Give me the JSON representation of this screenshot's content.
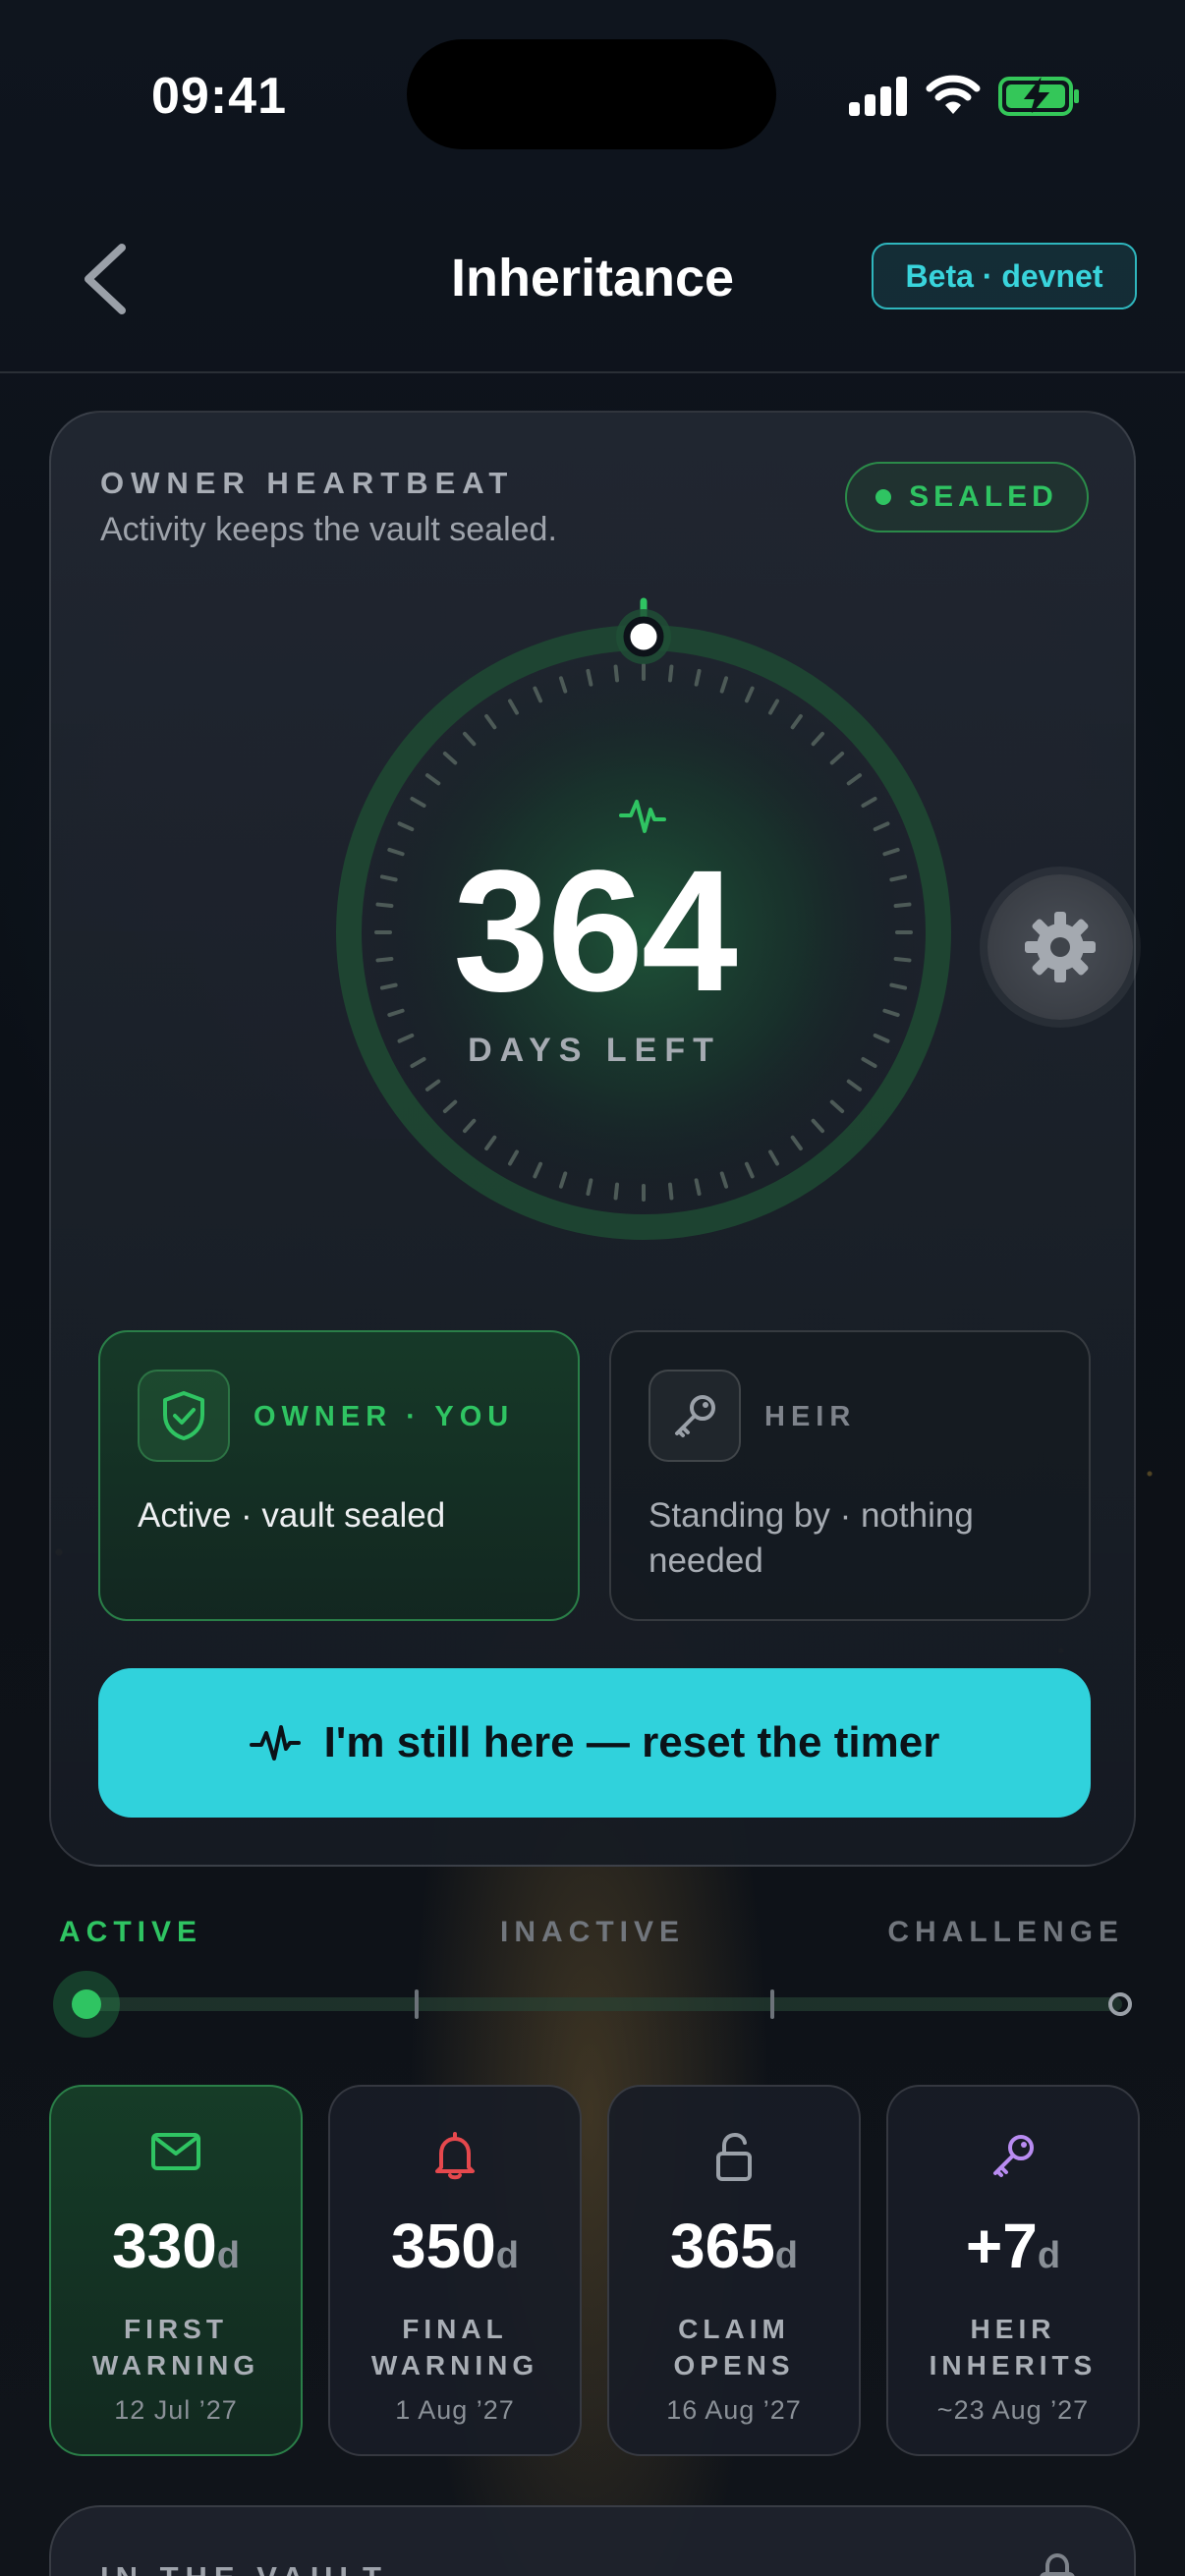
{
  "status_bar": {
    "time": "09:41"
  },
  "nav": {
    "title": "Inheritance",
    "badge": "Beta · devnet"
  },
  "heartbeat": {
    "title": "OWNER HEARTBEAT",
    "subtitle": "Activity keeps the vault sealed.",
    "status": "SEALED",
    "days_left": "364",
    "days_left_label": "DAYS LEFT"
  },
  "roles": {
    "owner": {
      "label": "OWNER · YOU",
      "desc": "Active · vault sealed"
    },
    "heir": {
      "label": "HEIR",
      "desc": "Standing by · nothing needed"
    }
  },
  "reset_button": {
    "label": "I'm still here — reset the timer"
  },
  "timeline": {
    "stages": [
      "ACTIVE",
      "INACTIVE",
      "CHALLENGE"
    ],
    "progress": 0
  },
  "milestones": [
    {
      "icon": "mail-icon",
      "value": "330",
      "unit": "d",
      "label_line1": "FIRST",
      "label_line2": "WARNING",
      "date": "12 Jul ’27"
    },
    {
      "icon": "bell-icon",
      "value": "350",
      "unit": "d",
      "label_line1": "FINAL",
      "label_line2": "WARNING",
      "date": "1 Aug ’27"
    },
    {
      "icon": "unlock-icon",
      "value": "365",
      "unit": "d",
      "label_line1": "CLAIM",
      "label_line2": "OPENS",
      "date": "16 Aug ’27"
    },
    {
      "icon": "key-icon",
      "value": "+7",
      "unit": "d",
      "label_line1": "HEIR",
      "label_line2": "INHERITS",
      "date": "~23 Aug ’27"
    }
  ],
  "vault": {
    "title": "IN THE VAULT"
  },
  "colors": {
    "accent_green": "#2fc462",
    "accent_cyan": "#30d2dc",
    "danger": "#e5484d",
    "heir_purple": "#b98cf2"
  }
}
